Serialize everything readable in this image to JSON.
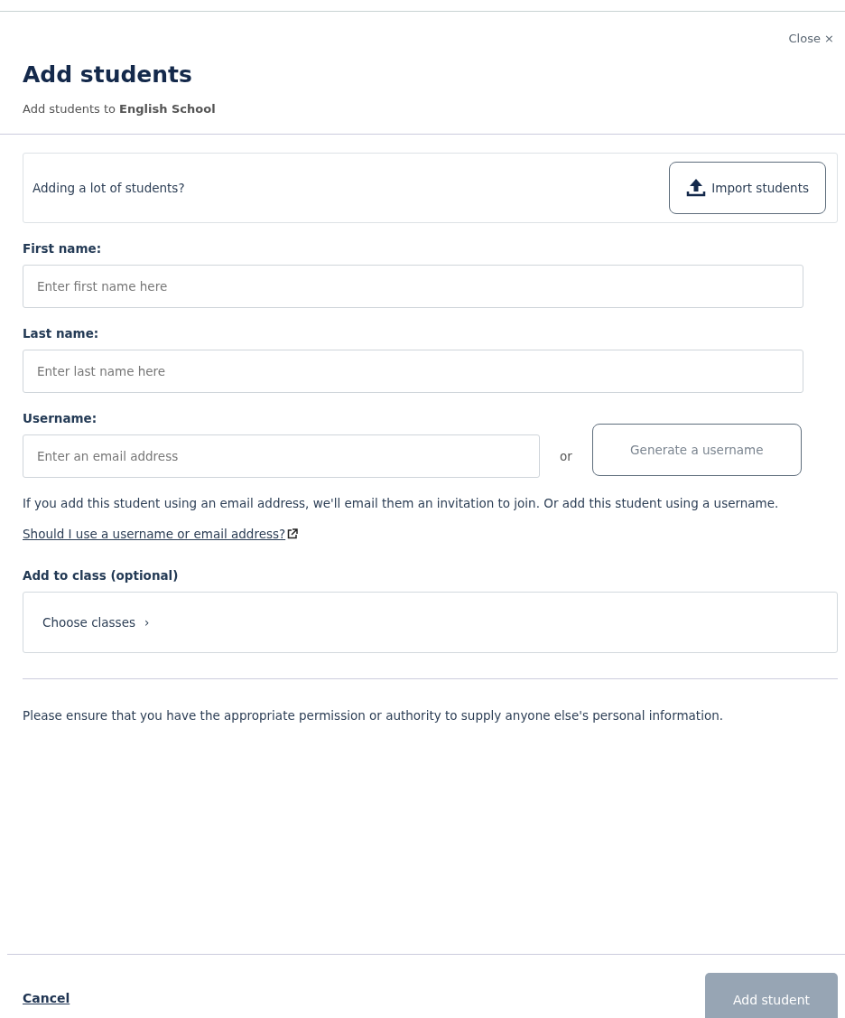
{
  "close": {
    "label": "Close",
    "icon": "×"
  },
  "header": {
    "title": "Add students",
    "subtitle": "Add students to **English School**"
  },
  "import": {
    "prompt": "Adding a lot of students?",
    "button": "Import students"
  },
  "fields": [
    {
      "label": "First name:",
      "placeholder": "Enter first name here"
    },
    {
      "label": "Last name:",
      "placeholder": "Enter last name here"
    }
  ],
  "username": {
    "label": "Username:",
    "placeholder": "Enter an email address",
    "separator": "or",
    "generate_button": "Generate a username"
  },
  "help_text": "If you add this student using an email address, we'll email them an invitation to join. Or add this student using a username.",
  "help_link": "Should I use a username or email address?",
  "class": {
    "label": "Add to class (optional)",
    "chooser": "Choose classes",
    "chevron": "›"
  },
  "notice": "Please ensure that you have the appropriate permission or authority to supply anyone else's personal information.",
  "footer": {
    "cancel": "Cancel",
    "submit": {
      "label": "Add student",
      "disabled": true
    }
  }
}
